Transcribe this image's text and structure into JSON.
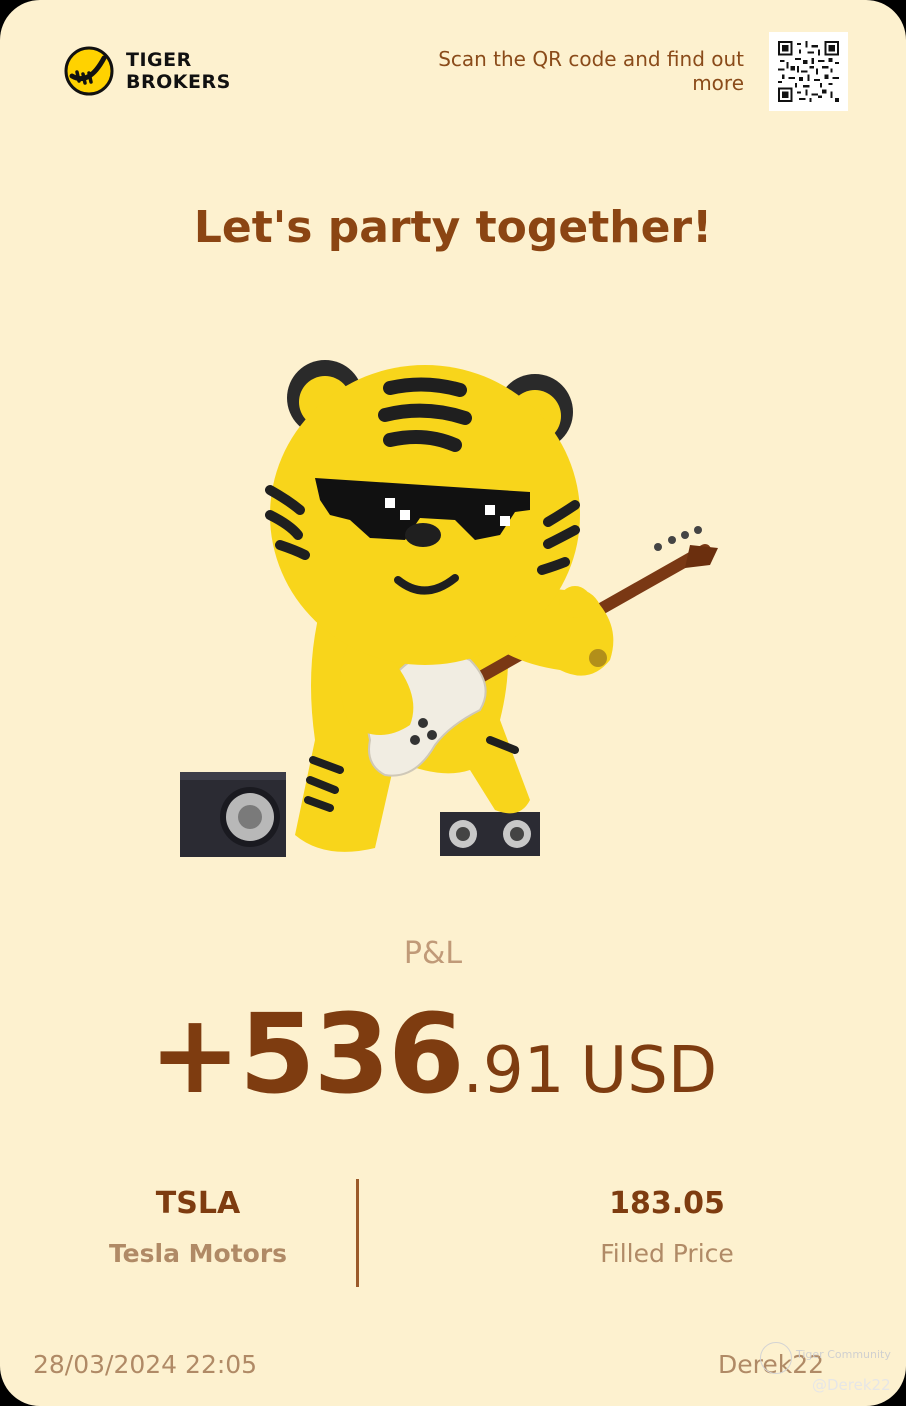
{
  "brand": {
    "line1": "TIGER",
    "line2": "BROKERS",
    "logo_icon": "tiger-claw-logo-icon"
  },
  "header": {
    "scan_text": "Scan the QR code and find out more",
    "qr_icon": "qr-code-icon"
  },
  "headline": "Let's party together!",
  "illustration": "tiger-mascot-guitar-icon",
  "pnl": {
    "label": "P&L",
    "integer": "+536",
    "decimal": ".91",
    "currency": "USD"
  },
  "stock": {
    "ticker": "TSLA",
    "name": "Tesla Motors"
  },
  "fill": {
    "price": "183.05",
    "label": "Filled Price"
  },
  "footer": {
    "date": "28/03/2024 22:05",
    "user": "Derek22"
  },
  "watermark": {
    "brand": "Tiger Community",
    "user": "@Derek22"
  },
  "colors": {
    "background": "#fdf1cf",
    "accent": "#8b4513",
    "muted": "#b08a66"
  }
}
